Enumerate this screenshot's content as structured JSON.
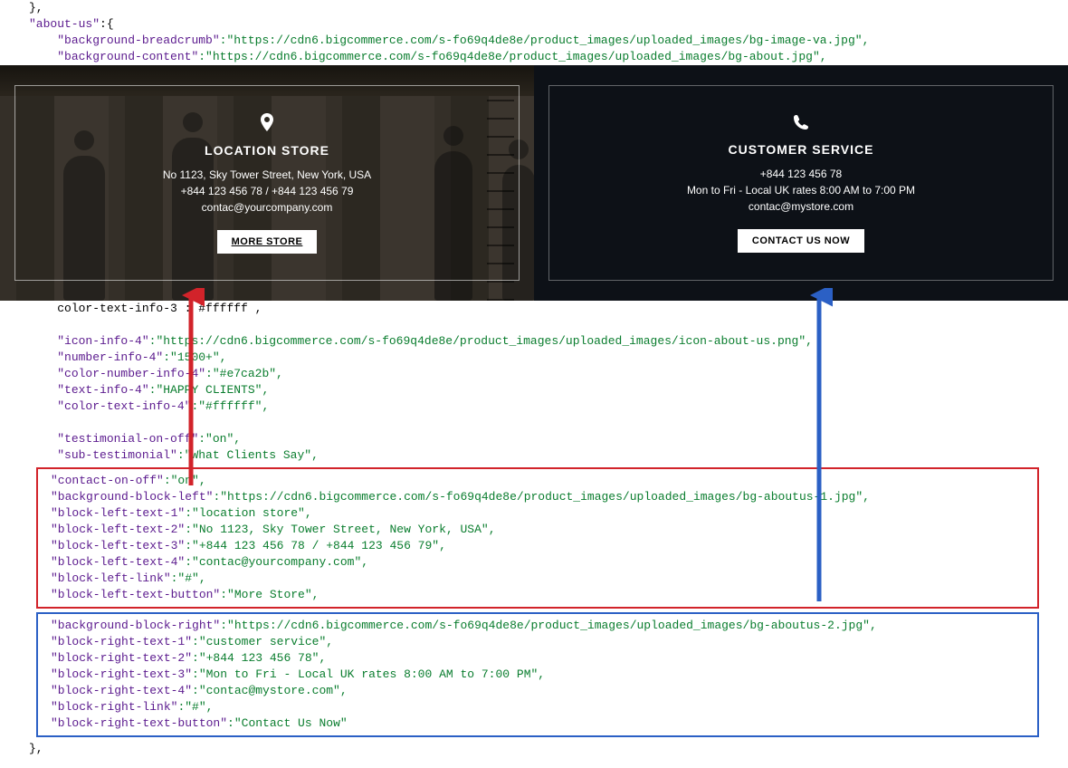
{
  "code_top": {
    "l1a": "\"about-us\"",
    "l1b": ":{",
    "l2k": "\"background-breadcrumb\"",
    "l2v": ":\"https://cdn6.bigcommerce.com/s-fo69q4de8e/product_images/uploaded_images/bg-image-va.jpg\",",
    "l3k": "\"background-content\"",
    "l3v": ":\"https://cdn6.bigcommerce.com/s-fo69q4de8e/product_images/uploaded_images/bg-about.jpg\","
  },
  "banner": {
    "left": {
      "title": "LOCATION STORE",
      "line1": "No 1123, Sky Tower Street, New York, USA",
      "line2": "+844 123 456 78 / +844 123 456 79",
      "line3": "contac@yourcompany.com",
      "button": "MORE STORE"
    },
    "right": {
      "title": "CUSTOMER SERVICE",
      "line1": "+844 123 456 78",
      "line2": "Mon to Fri - Local UK rates 8:00 AM to 7:00 PM",
      "line3": "contac@mystore.com",
      "button": "CONTACT US NOW"
    }
  },
  "mid": {
    "clip": "color-text-info-3 : #ffffff ,",
    "l1k": "\"icon-info-4\"",
    "l1v": ":\"https://cdn6.bigcommerce.com/s-fo69q4de8e/product_images/uploaded_images/icon-about-us.png\",",
    "l2k": "\"number-info-4\"",
    "l2v": ":\"1500+\",",
    "l3k": "\"color-number-info-4\"",
    "l3v": ":\"#e7ca2b\",",
    "l4k": "\"text-info-4\"",
    "l4v": ":\"HAPPY CLIENTS\",",
    "l5k": "\"color-text-info-4\"",
    "l5v": ":\"#ffffff\",",
    "l6k": "\"testimonial-on-off\"",
    "l6v": ":\"on\",",
    "l7k": "\"sub-testimonial\"",
    "l7v": ":\"What Clients Say\","
  },
  "red": {
    "l1k": "\"contact-on-off\"",
    "l1v": ":\"on\",",
    "l2k": "\"background-block-left\"",
    "l2v": ":\"https://cdn6.bigcommerce.com/s-fo69q4de8e/product_images/uploaded_images/bg-aboutus-1.jpg\",",
    "l3k": "\"block-left-text-1\"",
    "l3v": ":\"location store\",",
    "l4k": "\"block-left-text-2\"",
    "l4v": ":\"No 1123, Sky Tower Street, New York, USA\",",
    "l5k": "\"block-left-text-3\"",
    "l5v": ":\"+844 123 456 78 / +844 123 456 79\",",
    "l6k": "\"block-left-text-4\"",
    "l6v": ":\"contac@yourcompany.com\",",
    "l7k": "\"block-left-link\"",
    "l7v": ":\"#\",",
    "l8k": "\"block-left-text-button\"",
    "l8v": ":\"More Store\","
  },
  "blue": {
    "l1k": "\"background-block-right\"",
    "l1v": ":\"https://cdn6.bigcommerce.com/s-fo69q4de8e/product_images/uploaded_images/bg-aboutus-2.jpg\",",
    "l2k": "\"block-right-text-1\"",
    "l2v": ":\"customer service\",",
    "l3k": "\"block-right-text-2\"",
    "l3v": ":\"+844 123 456 78\",",
    "l4k": "\"block-right-text-3\"",
    "l4v": ":\"Mon to Fri - Local UK rates 8:00 AM to 7:00 PM\",",
    "l5k": "\"block-right-text-4\"",
    "l5v": ":\"contac@mystore.com\",",
    "l6k": "\"block-right-link\"",
    "l6v": ":\"#\",",
    "l7k": "\"block-right-text-button\"",
    "l7v": ":\"Contact Us Now\""
  },
  "tail": "},"
}
